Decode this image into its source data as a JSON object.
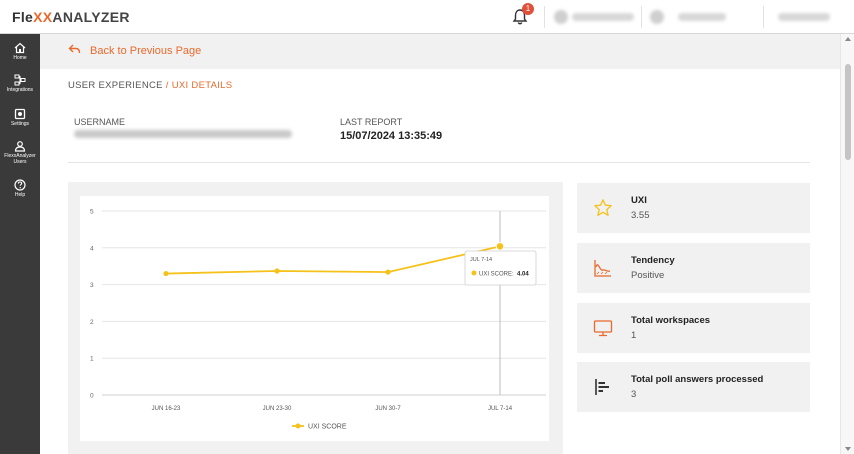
{
  "app": {
    "logo_part1": "Fle",
    "logo_part2": "XX",
    "logo_part3": "ANALYZER",
    "notification_count": "1"
  },
  "sidebar": {
    "items": [
      {
        "label": "Home",
        "icon": "home-icon"
      },
      {
        "label": "Integrations",
        "icon": "integrations-icon"
      },
      {
        "label": "Settings",
        "icon": "settings-icon"
      },
      {
        "label": "FlexxAnalyzer Users",
        "icon": "user-icon"
      },
      {
        "label": "Help",
        "icon": "help-icon"
      }
    ]
  },
  "back_label": "Back to Previous Page",
  "breadcrumb": {
    "root": "USER EXPERIENCE",
    "separator": "/",
    "current": "UXI DETAILS"
  },
  "details": {
    "username_label": "USERNAME",
    "last_report_label": "LAST REPORT",
    "last_report_value": "15/07/2024 13:35:49"
  },
  "cards": [
    {
      "title": "UXI",
      "value": "3.55",
      "icon": "star-icon"
    },
    {
      "title": "Tendency",
      "value": "Positive",
      "icon": "tendency-icon"
    },
    {
      "title": "Total workspaces",
      "value": "1",
      "icon": "monitor-icon"
    },
    {
      "title": "Total poll answers processed",
      "value": "3",
      "icon": "bar-list-icon"
    }
  ],
  "colors": {
    "accent": "#e86a2c",
    "series": "#f5c21b",
    "sidebar": "#3a3a3a"
  },
  "chart_data": {
    "type": "line",
    "categories": [
      "JUN 16-23",
      "JUN 23-30",
      "JUN 30-7",
      "JUL 7-14"
    ],
    "series": [
      {
        "name": "UXI SCORE",
        "values": [
          3.3,
          3.37,
          3.34,
          4.04
        ]
      }
    ],
    "ylim": [
      0,
      5
    ],
    "yticks": [
      0,
      1,
      2,
      3,
      4,
      5
    ],
    "grid": true,
    "legend": "bottom",
    "tooltip": {
      "title": "JUL 7-14",
      "label": "UXI SCORE:",
      "value": "4.04"
    }
  }
}
